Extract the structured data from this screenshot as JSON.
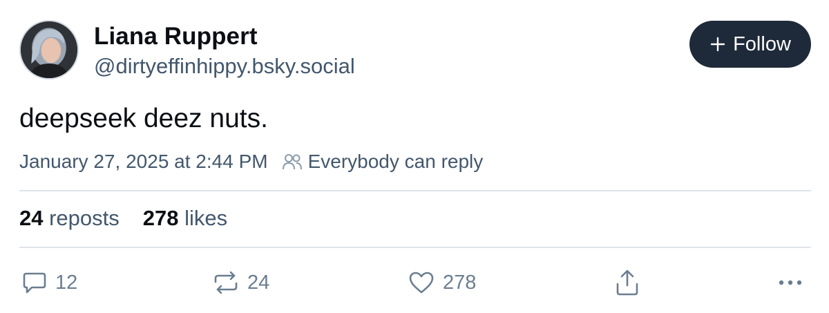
{
  "author": {
    "display_name": "Liana Ruppert",
    "handle": "@dirtyeffinhippy.bsky.social",
    "avatar_icon": "avatar-photo"
  },
  "follow_button": {
    "label": "Follow",
    "icon": "plus-icon",
    "background": "#1e2a39"
  },
  "post": {
    "text": "deepseek deez nuts.",
    "timestamp": "January 27, 2025 at 2:44 PM",
    "reply_setting": "Everybody can reply",
    "reply_setting_icon": "people-icon"
  },
  "stats": {
    "reposts_count": "24",
    "reposts_label": "reposts",
    "likes_count": "278",
    "likes_label": "likes"
  },
  "actions": {
    "reply": {
      "icon": "comment-icon",
      "count": "12"
    },
    "repost": {
      "icon": "repost-icon",
      "count": "24"
    },
    "like": {
      "icon": "heart-icon",
      "count": "278"
    },
    "share": {
      "icon": "share-icon"
    },
    "more": {
      "icon": "more-icon"
    }
  },
  "colors": {
    "text_primary": "#0b0f14",
    "text_secondary": "#42576c",
    "icon_muted": "#6a7d90",
    "divider": "#dde3e9"
  }
}
